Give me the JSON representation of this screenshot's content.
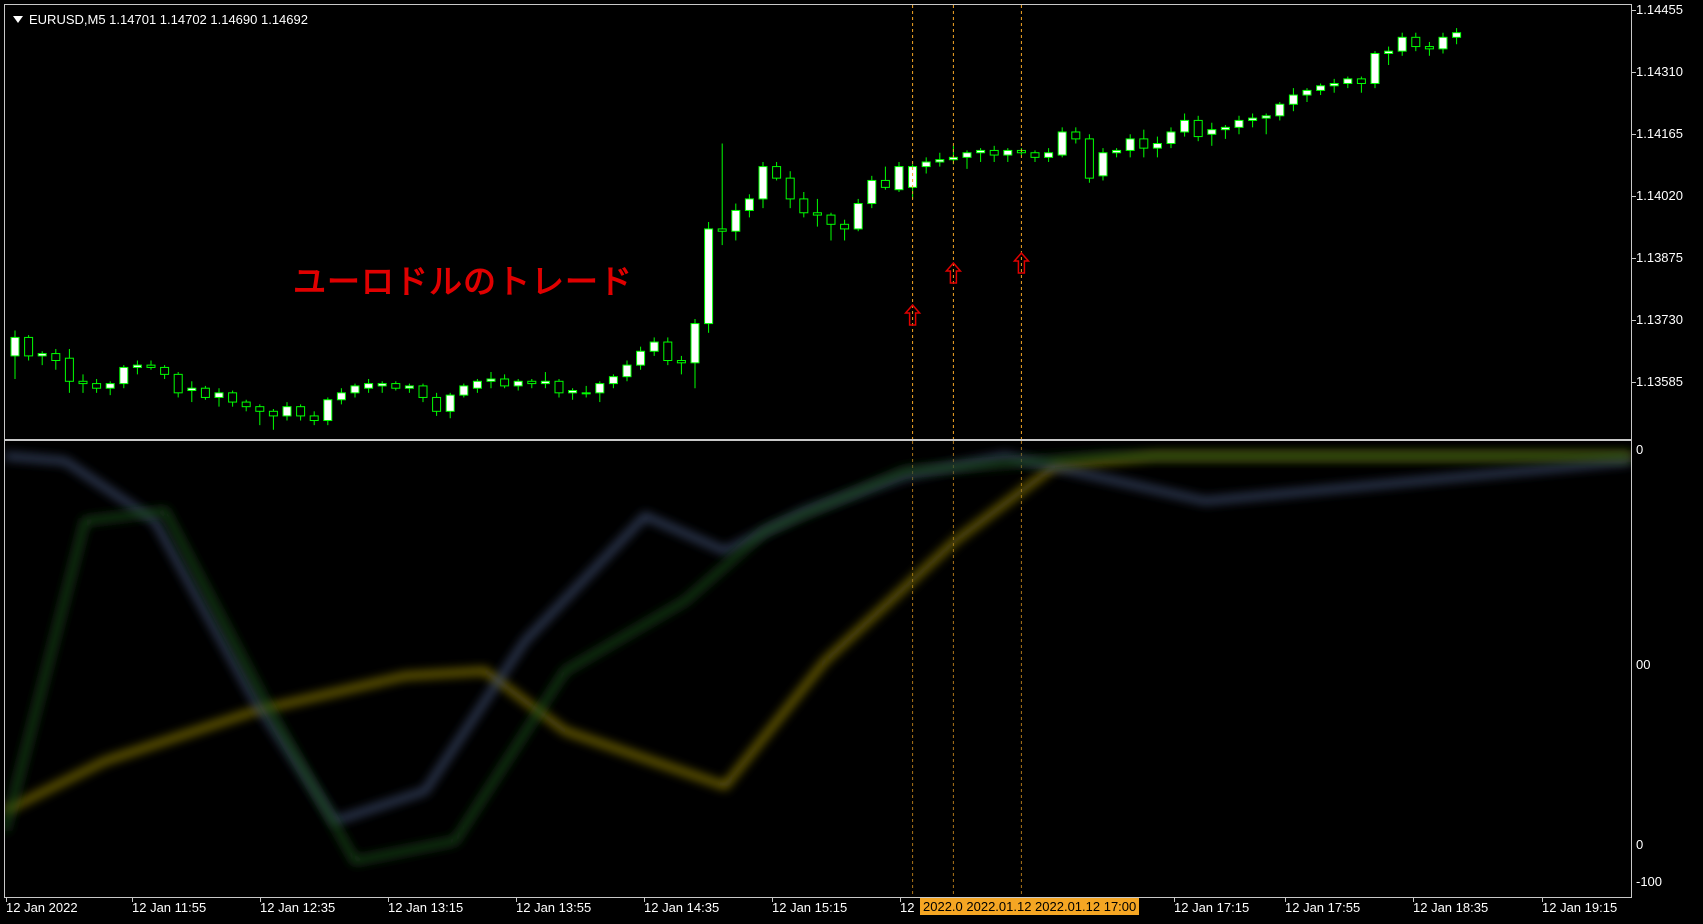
{
  "window": {
    "symbol_info": "EURUSD,M5  1.14701 1.14702 1.14690 1.14692"
  },
  "annotation": {
    "text": "ユーロドルのトレード",
    "color": "#e00000"
  },
  "price_axis": {
    "labels": [
      "1.14455",
      "1.14310",
      "1.14165",
      "1.14020",
      "1.13875",
      "1.13730",
      "1.13585"
    ]
  },
  "indicator_axis": {
    "labels": [
      "0",
      "00",
      "0",
      "-100"
    ]
  },
  "time_axis": {
    "labels": [
      "12 Jan 2022",
      "12 Jan 11:55",
      "12 Jan 12:35",
      "12 Jan 13:15",
      "12 Jan 13:55",
      "12 Jan 14:35",
      "12 Jan 15:15",
      "12",
      "12 Jan 17:15",
      "12 Jan 17:55",
      "12 Jan 18:35",
      "12 Jan 19:15"
    ],
    "highlight": "2022.0 2022.01.12  2022.01.12 17:00"
  },
  "colors": {
    "bull": "#ffffff",
    "wick": "#00ff00",
    "bear_body": "#000000",
    "vline": "#f5a623",
    "arrow": "#e00000",
    "background": "#000000"
  },
  "arrows": [
    {
      "icon": "up-arrow-icon"
    },
    {
      "icon": "up-arrow-icon"
    },
    {
      "icon": "up-arrow-icon"
    }
  ],
  "chart_data": {
    "type": "candlestick",
    "symbol": "EURUSD",
    "timeframe": "M5",
    "ylim": [
      1.1354,
      1.1448
    ],
    "candles": [
      [
        1.1372,
        1.13775,
        1.1367,
        1.1376
      ],
      [
        1.1376,
        1.13765,
        1.1371,
        1.1372
      ],
      [
        1.1372,
        1.1373,
        1.137,
        1.13725
      ],
      [
        1.13725,
        1.13735,
        1.1369,
        1.1371
      ],
      [
        1.13715,
        1.13735,
        1.1364,
        1.13665
      ],
      [
        1.13665,
        1.1368,
        1.1364,
        1.1366
      ],
      [
        1.1366,
        1.1367,
        1.1364,
        1.1365
      ],
      [
        1.1365,
        1.13665,
        1.13635,
        1.1366
      ],
      [
        1.1366,
        1.137,
        1.1365,
        1.13695
      ],
      [
        1.13695,
        1.1371,
        1.1368,
        1.137
      ],
      [
        1.137,
        1.1371,
        1.1369,
        1.13695
      ],
      [
        1.13695,
        1.137,
        1.1367,
        1.1368
      ],
      [
        1.1368,
        1.13685,
        1.1363,
        1.1364
      ],
      [
        1.13645,
        1.13665,
        1.1362,
        1.1365
      ],
      [
        1.1365,
        1.13655,
        1.13625,
        1.1363
      ],
      [
        1.1363,
        1.1365,
        1.1361,
        1.1364
      ],
      [
        1.1364,
        1.13645,
        1.1361,
        1.1362
      ],
      [
        1.1362,
        1.13625,
        1.136,
        1.1361
      ],
      [
        1.1361,
        1.13615,
        1.1357,
        1.136
      ],
      [
        1.136,
        1.13605,
        1.1356,
        1.1359
      ],
      [
        1.1359,
        1.1362,
        1.1358,
        1.1361
      ],
      [
        1.1361,
        1.13615,
        1.1358,
        1.1359
      ],
      [
        1.1359,
        1.136,
        1.1357,
        1.1358
      ],
      [
        1.1358,
        1.1363,
        1.1357,
        1.13625
      ],
      [
        1.13625,
        1.1365,
        1.13615,
        1.1364
      ],
      [
        1.1364,
        1.1366,
        1.1363,
        1.13655
      ],
      [
        1.1365,
        1.1367,
        1.1364,
        1.1366
      ],
      [
        1.13655,
        1.13665,
        1.1364,
        1.1366
      ],
      [
        1.1366,
        1.13665,
        1.13645,
        1.1365
      ],
      [
        1.1365,
        1.1366,
        1.1364,
        1.13655
      ],
      [
        1.13655,
        1.1366,
        1.1362,
        1.1363
      ],
      [
        1.1363,
        1.1364,
        1.1359,
        1.136
      ],
      [
        1.136,
        1.1364,
        1.13585,
        1.13635
      ],
      [
        1.13635,
        1.1366,
        1.1363,
        1.13655
      ],
      [
        1.1365,
        1.1367,
        1.1364,
        1.13665
      ],
      [
        1.13665,
        1.13685,
        1.1365,
        1.1367
      ],
      [
        1.1367,
        1.1368,
        1.1365,
        1.13655
      ],
      [
        1.13655,
        1.1367,
        1.13645,
        1.13665
      ],
      [
        1.13665,
        1.1367,
        1.1365,
        1.1366
      ],
      [
        1.1366,
        1.13685,
        1.1365,
        1.13665
      ],
      [
        1.13665,
        1.1367,
        1.1363,
        1.1364
      ],
      [
        1.1364,
        1.1365,
        1.13625,
        1.13645
      ],
      [
        1.1364,
        1.13655,
        1.1363,
        1.1364
      ],
      [
        1.1364,
        1.13665,
        1.1362,
        1.1366
      ],
      [
        1.1366,
        1.1368,
        1.1365,
        1.13675
      ],
      [
        1.13675,
        1.1371,
        1.13665,
        1.137
      ],
      [
        1.137,
        1.1374,
        1.1369,
        1.1373
      ],
      [
        1.1373,
        1.1376,
        1.1372,
        1.1375
      ],
      [
        1.1375,
        1.1376,
        1.137,
        1.1371
      ],
      [
        1.1371,
        1.1372,
        1.1368,
        1.13705
      ],
      [
        1.13705,
        1.138,
        1.1365,
        1.1379
      ],
      [
        1.1379,
        1.1401,
        1.1377,
        1.13995
      ],
      [
        1.13995,
        1.1418,
        1.1396,
        1.1399
      ],
      [
        1.1399,
        1.1405,
        1.1397,
        1.14035
      ],
      [
        1.14035,
        1.1407,
        1.1402,
        1.1406
      ],
      [
        1.1406,
        1.1414,
        1.1404,
        1.1413
      ],
      [
        1.1413,
        1.1414,
        1.141,
        1.14105
      ],
      [
        1.14105,
        1.1412,
        1.1404,
        1.1406
      ],
      [
        1.1406,
        1.14075,
        1.1402,
        1.1403
      ],
      [
        1.1403,
        1.1406,
        1.14,
        1.14025
      ],
      [
        1.14025,
        1.1403,
        1.1397,
        1.14005
      ],
      [
        1.14005,
        1.14015,
        1.1397,
        1.13995
      ],
      [
        1.13995,
        1.1406,
        1.1399,
        1.1405
      ],
      [
        1.1405,
        1.1411,
        1.1404,
        1.141
      ],
      [
        1.141,
        1.1413,
        1.1408,
        1.14085
      ],
      [
        1.1408,
        1.1414,
        1.14075,
        1.1413
      ],
      [
        1.14085,
        1.14135,
        1.1406,
        1.1413
      ],
      [
        1.1413,
        1.1415,
        1.14115,
        1.1414
      ],
      [
        1.1414,
        1.1416,
        1.1413,
        1.14145
      ],
      [
        1.14145,
        1.14175,
        1.14135,
        1.1415
      ],
      [
        1.1415,
        1.14165,
        1.14125,
        1.1416
      ],
      [
        1.1416,
        1.1417,
        1.1414,
        1.14165
      ],
      [
        1.14165,
        1.14175,
        1.1414,
        1.14155
      ],
      [
        1.14155,
        1.1417,
        1.1414,
        1.14165
      ],
      [
        1.14165,
        1.1417,
        1.14155,
        1.1416
      ],
      [
        1.1416,
        1.14165,
        1.1414,
        1.1415
      ],
      [
        1.1415,
        1.1417,
        1.1414,
        1.1416
      ],
      [
        1.14155,
        1.14215,
        1.1415,
        1.14205
      ],
      [
        1.14205,
        1.14215,
        1.1418,
        1.1419
      ],
      [
        1.1419,
        1.142,
        1.14095,
        1.14105
      ],
      [
        1.1411,
        1.1417,
        1.141,
        1.1416
      ],
      [
        1.1416,
        1.1417,
        1.1415,
        1.14165
      ],
      [
        1.14165,
        1.142,
        1.1415,
        1.1419
      ],
      [
        1.1419,
        1.1421,
        1.1415,
        1.1417
      ],
      [
        1.1417,
        1.14195,
        1.1415,
        1.1418
      ],
      [
        1.1418,
        1.14215,
        1.1417,
        1.14205
      ],
      [
        1.14205,
        1.14245,
        1.14195,
        1.1423
      ],
      [
        1.1423,
        1.1424,
        1.14185,
        1.14195
      ],
      [
        1.142,
        1.14225,
        1.14175,
        1.1421
      ],
      [
        1.1421,
        1.1422,
        1.1419,
        1.14215
      ],
      [
        1.14215,
        1.1424,
        1.142,
        1.1423
      ],
      [
        1.1423,
        1.14245,
        1.14215,
        1.14235
      ],
      [
        1.14235,
        1.14245,
        1.142,
        1.1424
      ],
      [
        1.1424,
        1.1427,
        1.1423,
        1.14265
      ],
      [
        1.14265,
        1.143,
        1.1425,
        1.14285
      ],
      [
        1.14285,
        1.143,
        1.1427,
        1.14295
      ],
      [
        1.14295,
        1.1431,
        1.14285,
        1.14305
      ],
      [
        1.14305,
        1.1432,
        1.1429,
        1.1431
      ],
      [
        1.1431,
        1.14325,
        1.143,
        1.1432
      ],
      [
        1.1432,
        1.14325,
        1.1429,
        1.1431
      ],
      [
        1.1431,
        1.1438,
        1.143,
        1.14375
      ],
      [
        1.14375,
        1.1439,
        1.1435,
        1.1438
      ],
      [
        1.1438,
        1.1442,
        1.1437,
        1.1441
      ],
      [
        1.1441,
        1.1442,
        1.1438,
        1.1439
      ],
      [
        1.1439,
        1.144,
        1.1437,
        1.14385
      ],
      [
        1.14385,
        1.1442,
        1.14375,
        1.1441
      ],
      [
        1.1441,
        1.1443,
        1.14395,
        1.1442
      ]
    ]
  }
}
